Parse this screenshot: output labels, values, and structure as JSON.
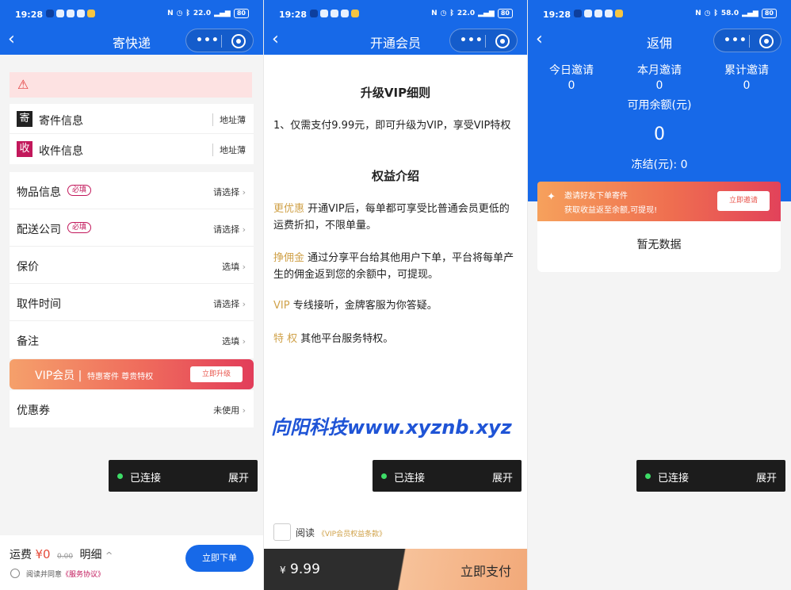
{
  "status": {
    "time": "19:28",
    "battery": "80",
    "net1": "22.0",
    "net2": "58.0"
  },
  "panel1": {
    "nav_title": "寄快递",
    "alert_icon": "warning-icon",
    "sender": {
      "badge": "寄",
      "label": "寄件信息",
      "link": "地址薄",
      "color": "#222222"
    },
    "receiver": {
      "badge": "收",
      "label": "收件信息",
      "link": "地址薄",
      "color": "#c2185b"
    },
    "rows": [
      {
        "label": "物品信息",
        "required": "必填",
        "value": "请选择"
      },
      {
        "label": "配送公司",
        "required": "必填",
        "value": "请选择"
      },
      {
        "label": "保价",
        "required": "",
        "value": "选填"
      },
      {
        "label": "取件时间",
        "required": "",
        "value": "请选择"
      },
      {
        "label": "备注",
        "required": "",
        "value": "选填"
      }
    ],
    "vip": {
      "name": "VIP会员",
      "divider": "|",
      "sub": "特惠寄件 尊贵特权",
      "button": "立即升级"
    },
    "coupon": {
      "label": "优惠券",
      "value": "未使用"
    },
    "toast": {
      "status": "已连接",
      "action": "展开"
    },
    "footer": {
      "fee_label": "运费",
      "fee": "¥0",
      "original": "0.00",
      "detail": "明细",
      "chevron": "^",
      "agree": "阅读并同意",
      "agree_link": "《服务协议》",
      "order": "立即下单"
    }
  },
  "panel2": {
    "nav_title": "开通会员",
    "heading1": "升级VIP细则",
    "rule": "1、仅需支付9.99元，即可升级为VIP，享受VIP特权",
    "heading2": "权益介绍",
    "benefits": [
      {
        "key": "更优惠",
        "text": "开通VIP后，每单都可享受比普通会员更低的运费折扣，不限单量。"
      },
      {
        "key": "挣佣金",
        "text": "通过分享平台给其他用户下单，平台将每单产生的佣金返到您的余额中，可提现。"
      },
      {
        "key": "VIP",
        "text": "专线接听，金牌客服为你答疑。"
      },
      {
        "key": "特 权",
        "text": "其他平台服务特权。"
      }
    ],
    "watermark": "向阳科技www.xyznb.xyz",
    "toast": {
      "status": "已连接",
      "action": "展开"
    },
    "agree": "阅读",
    "agree_link": "《VIP会员权益条款》",
    "price_symbol": "¥",
    "price": "9.99",
    "pay": "立即支付"
  },
  "panel3": {
    "nav_title": "返佣",
    "stats": [
      {
        "label": "今日邀请",
        "value": "0"
      },
      {
        "label": "本月邀请",
        "value": "0"
      },
      {
        "label": "累计邀请",
        "value": "0"
      }
    ],
    "balance_label": "可用余额(元)",
    "balance": "0",
    "frozen": "冻结(元): 0",
    "invite": {
      "icon": "gift-icon",
      "title": "邀请好友下单寄件",
      "sub": "获取收益返至余额,可提现!",
      "button": "立即邀请"
    },
    "empty": "暂无数据",
    "toast": {
      "status": "已连接",
      "action": "展开"
    }
  },
  "colors": {
    "primary": "#1769e8",
    "gold": "#d0a24a",
    "accent": "#e54b3a"
  }
}
